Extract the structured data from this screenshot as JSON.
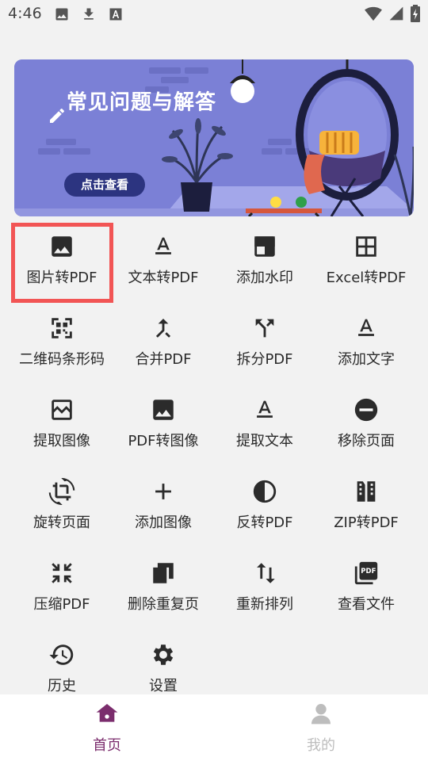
{
  "status_bar": {
    "time": "4:46",
    "left_icons": [
      "image-icon",
      "download-icon",
      "font-icon"
    ],
    "right_icons": [
      "wifi-icon",
      "signal-icon",
      "battery-icon"
    ]
  },
  "banner": {
    "title": "常见问题与解答",
    "button_label": "点击查看",
    "background_color": "#7b80d6",
    "button_color": "#2c3480"
  },
  "tools": [
    {
      "label": "图片转PDF",
      "icon": "image-icon",
      "highlighted": true
    },
    {
      "label": "文本转PDF",
      "icon": "text-format-icon"
    },
    {
      "label": "添加水印",
      "icon": "watermark-icon"
    },
    {
      "label": "Excel转PDF",
      "icon": "table-grid-icon"
    },
    {
      "label": "二维码条形码",
      "icon": "qr-code-icon"
    },
    {
      "label": "合并PDF",
      "icon": "merge-icon"
    },
    {
      "label": "拆分PDF",
      "icon": "split-icon"
    },
    {
      "label": "添加文字",
      "icon": "text-format-icon"
    },
    {
      "label": "提取图像",
      "icon": "photo-wave-icon"
    },
    {
      "label": "PDF转图像",
      "icon": "image-icon"
    },
    {
      "label": "提取文本",
      "icon": "text-format-icon"
    },
    {
      "label": "移除页面",
      "icon": "remove-circle-icon"
    },
    {
      "label": "旋转页面",
      "icon": "rotate-crop-icon"
    },
    {
      "label": "添加图像",
      "icon": "plus-icon"
    },
    {
      "label": "反转PDF",
      "icon": "contrast-icon"
    },
    {
      "label": "ZIP转PDF",
      "icon": "zip-icon"
    },
    {
      "label": "压缩PDF",
      "icon": "compress-icon"
    },
    {
      "label": "删除重复页",
      "icon": "duplicate-pages-icon"
    },
    {
      "label": "重新排列",
      "icon": "swap-vertical-icon"
    },
    {
      "label": "查看文件",
      "icon": "pdf-file-icon"
    },
    {
      "label": "历史",
      "icon": "history-icon"
    },
    {
      "label": "设置",
      "icon": "gear-icon"
    }
  ],
  "bottom_nav": {
    "home_label": "首页",
    "mine_label": "我的",
    "active_color": "#7b2d6d",
    "inactive_color": "#bdbdbd"
  },
  "highlight_color": "#f25555"
}
